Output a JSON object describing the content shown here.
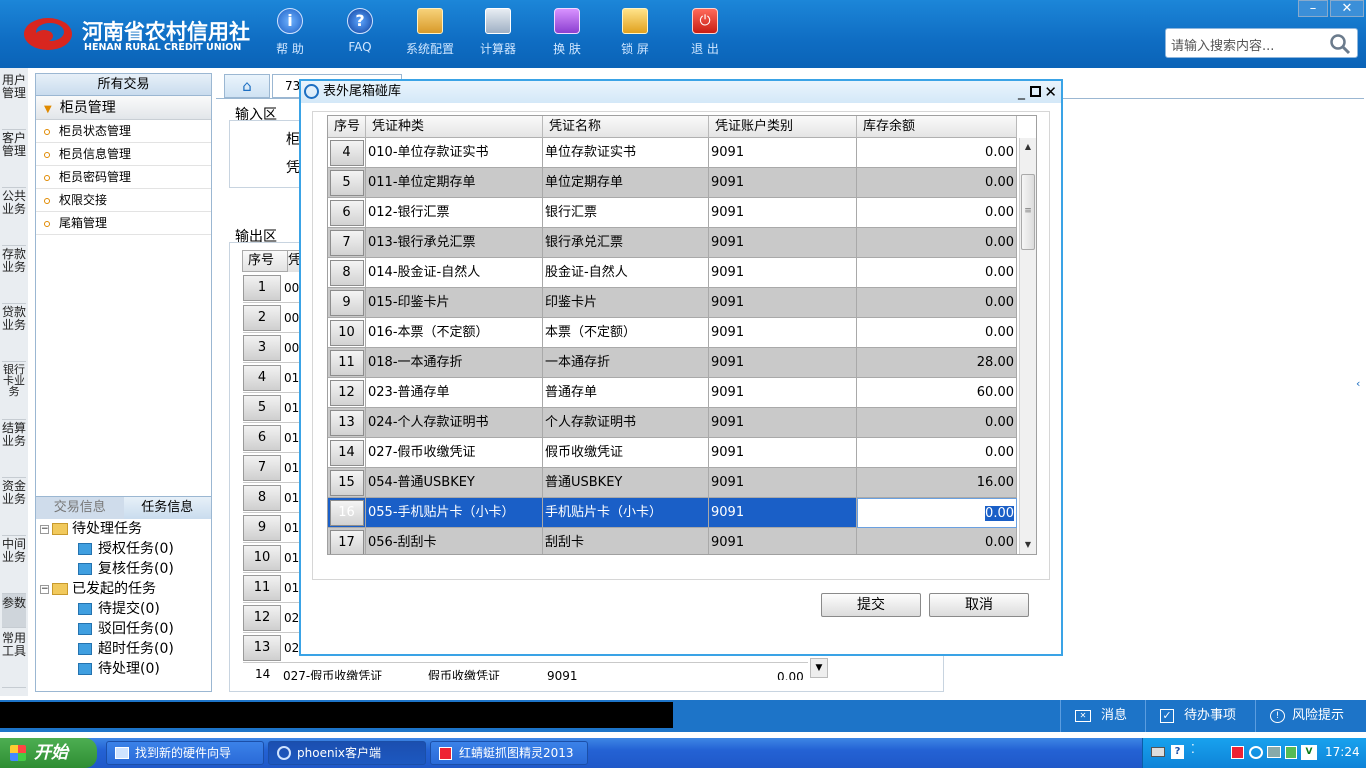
{
  "brand": {
    "name_cn": "河南省农村信用社",
    "name_en": "HENAN RURAL CREDIT UNION"
  },
  "toolbar": [
    {
      "label": "帮 助",
      "icon": "info-icon"
    },
    {
      "label": "FAQ",
      "icon": "faq-icon"
    },
    {
      "label": "系统配置",
      "icon": "config-icon"
    },
    {
      "label": "计算器",
      "icon": "calculator-icon"
    },
    {
      "label": "换 肤",
      "icon": "skin-icon"
    },
    {
      "label": "锁 屏",
      "icon": "lock-icon"
    },
    {
      "label": "退 出",
      "icon": "exit-icon"
    }
  ],
  "search": {
    "placeholder": "请输入搜索内容..."
  },
  "left_tabs": [
    "用户管理",
    "客户管理",
    "公共业务",
    "存款业务",
    "贷款业务",
    "银行卡业务",
    "结算业务",
    "资金业务",
    "中间业务",
    "参数",
    "常用工具"
  ],
  "menu": {
    "title": "所有交易",
    "group": "柜员管理",
    "items": [
      "柜员状态管理",
      "柜员信息管理",
      "柜员密码管理",
      "权限交接",
      "尾箱管理"
    ]
  },
  "tasks": {
    "tab1": "交易信息",
    "tab2": "任务信息",
    "pending": "待处理任务",
    "auth": "授权任务(0)",
    "review": "复核任务(0)",
    "initiated": "已发起的任务",
    "to_submit": "待提交(0)",
    "rejected": "驳回任务(0)",
    "timeout": "超时任务(0)",
    "to_process": "待处理(0)"
  },
  "content": {
    "tab_num": "73",
    "input_area": "输入区",
    "output_area": "输出区",
    "in_label1": "柜",
    "in_label2": "凭",
    "out_header1": "序号",
    "out_header2": "凭",
    "bg_rows": [
      [
        "1",
        "00"
      ],
      [
        "2",
        "00"
      ],
      [
        "3",
        "00"
      ],
      [
        "4",
        "01"
      ],
      [
        "5",
        "01"
      ],
      [
        "6",
        "01"
      ],
      [
        "7",
        "01"
      ],
      [
        "8",
        "01"
      ],
      [
        "9",
        "01"
      ],
      [
        "10",
        "01"
      ],
      [
        "11",
        "01"
      ],
      [
        "12",
        "02"
      ],
      [
        "13",
        "02"
      ]
    ],
    "bg_last": [
      "14",
      "027-假币收缴凭证",
      "假币收缴凭证",
      "9091",
      "0.00"
    ]
  },
  "dialog": {
    "title": "表外尾箱碰库",
    "columns": [
      "序号",
      "凭证种类",
      "凭证名称",
      "凭证账户类别",
      "库存余额"
    ],
    "rows": [
      [
        "4",
        "010-单位存款证实书",
        "单位存款证实书",
        "9091",
        "0.00"
      ],
      [
        "5",
        "011-单位定期存单",
        "单位定期存单",
        "9091",
        "0.00"
      ],
      [
        "6",
        "012-银行汇票",
        "银行汇票",
        "9091",
        "0.00"
      ],
      [
        "7",
        "013-银行承兑汇票",
        "银行承兑汇票",
        "9091",
        "0.00"
      ],
      [
        "8",
        "014-股金证-自然人",
        "股金证-自然人",
        "9091",
        "0.00"
      ],
      [
        "9",
        "015-印鉴卡片",
        "印鉴卡片",
        "9091",
        "0.00"
      ],
      [
        "10",
        "016-本票（不定额）",
        "本票（不定额）",
        "9091",
        "0.00"
      ],
      [
        "11",
        "018-一本通存折",
        "一本通存折",
        "9091",
        "28.00"
      ],
      [
        "12",
        "023-普通存单",
        "普通存单",
        "9091",
        "60.00"
      ],
      [
        "13",
        "024-个人存款证明书",
        "个人存款证明书",
        "9091",
        "0.00"
      ],
      [
        "14",
        "027-假币收缴凭证",
        "假币收缴凭证",
        "9091",
        "0.00"
      ],
      [
        "15",
        "054-普通USBKEY",
        "普通USBKEY",
        "9091",
        "16.00"
      ],
      [
        "16",
        "055-手机贴片卡（小卡）",
        "手机贴片卡（小卡）",
        "9091",
        "0.00"
      ],
      [
        "17",
        "056-刮刮卡",
        "刮刮卡",
        "9091",
        "0.00"
      ]
    ],
    "selected_row": "16",
    "submit": "提交",
    "cancel": "取消"
  },
  "status": {
    "msg": "消息",
    "todo": "待办事项",
    "risk": "风险提示"
  },
  "taskbar": {
    "start": "开始",
    "t1": "找到新的硬件向导",
    "t2": "phoenix客户端",
    "t3": "红蜻蜓抓图精灵2013",
    "clock": "17:24"
  }
}
